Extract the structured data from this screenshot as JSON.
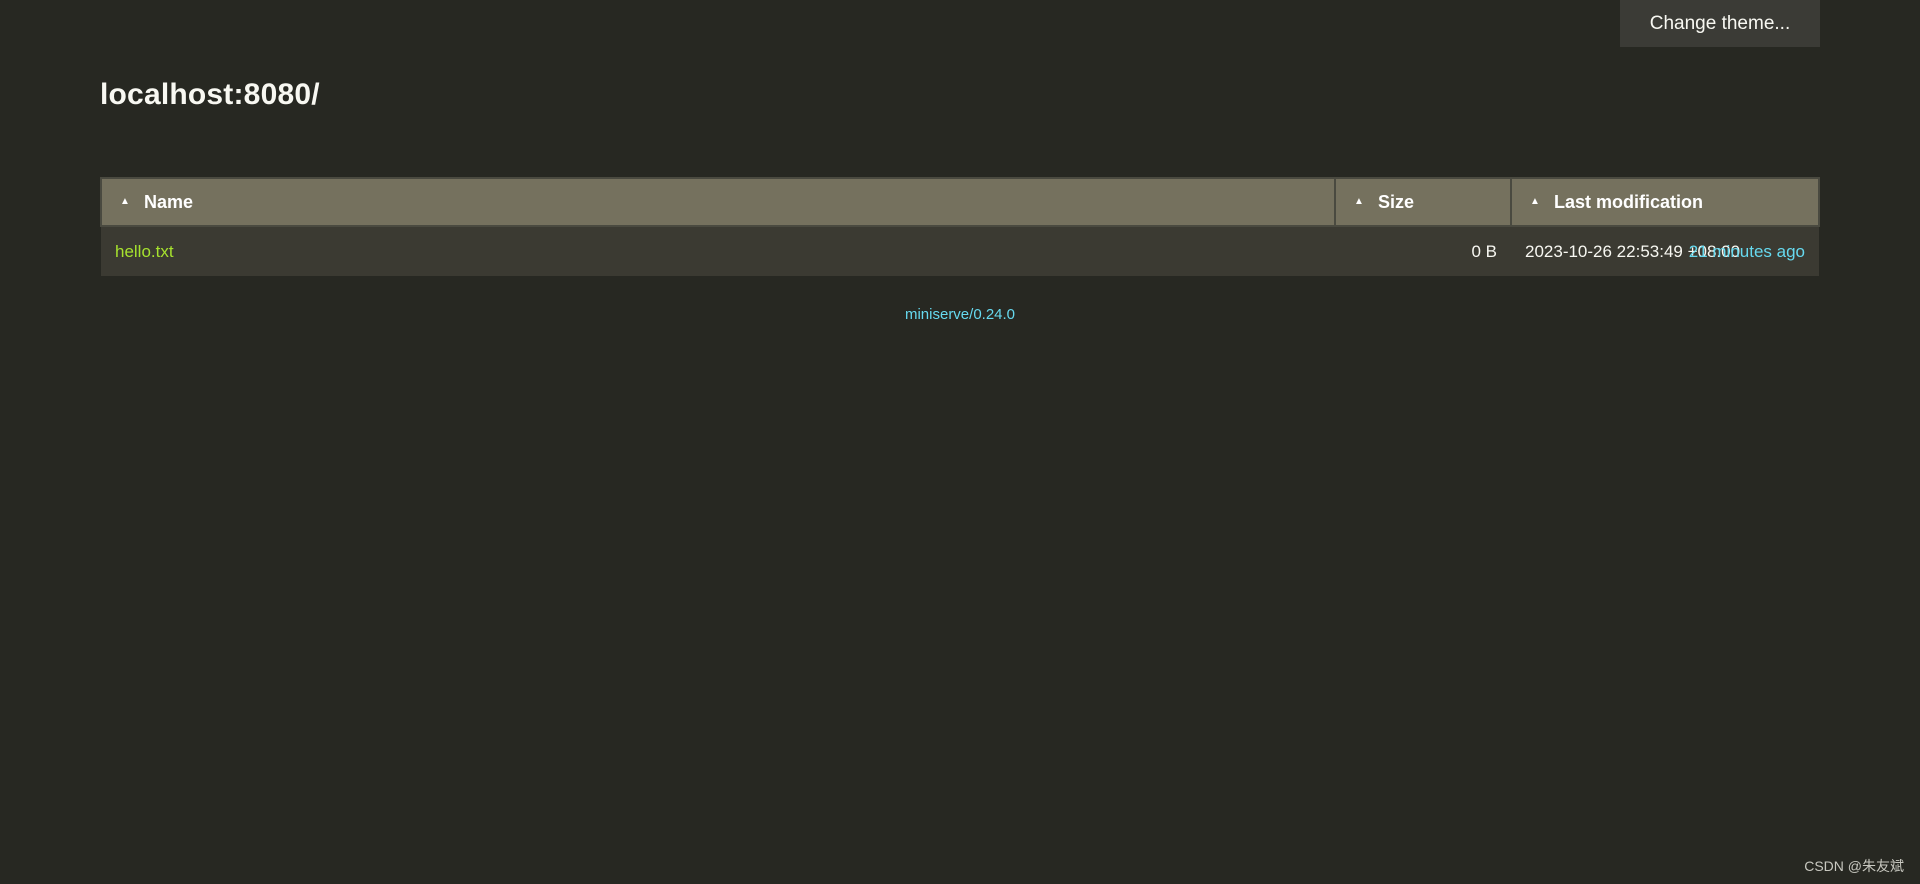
{
  "theme_button": {
    "label": "Change theme..."
  },
  "page": {
    "title": "localhost:8080/"
  },
  "table": {
    "sort_arrow": "▲",
    "headers": {
      "name": "Name",
      "size": "Size",
      "modified": "Last modification"
    },
    "rows": [
      {
        "name": "hello.txt",
        "size": "0 B",
        "date": "2023-10-26 22:53:49 +08:00",
        "relative": "21 minutes ago"
      }
    ]
  },
  "footer": {
    "version_link": "miniserve/0.24.0"
  },
  "watermark": {
    "text": "CSDN @朱友斌"
  },
  "colors": {
    "background": "#272822",
    "header_bg": "#75715e",
    "row_bg": "#3b3a32",
    "file_link": "#a6e22e",
    "accent_link": "#66d9ef"
  }
}
